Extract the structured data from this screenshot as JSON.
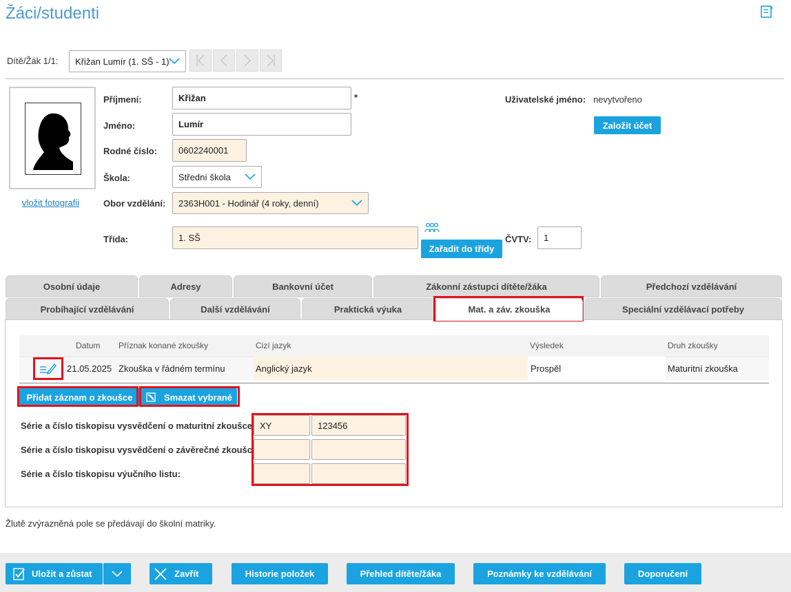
{
  "page": {
    "title": "Žáci/studenti"
  },
  "navigator": {
    "label": "Dítě/Žák 1/1:",
    "selected": "Křižan Lumír (1. SŠ - 1)"
  },
  "photo": {
    "link": "vložit fotografii"
  },
  "form": {
    "surname_label": "Příjmení:",
    "surname_value": "Křižan",
    "required_mark": "*",
    "name_label": "Jméno:",
    "name_value": "Lumír",
    "birth_label": "Rodné číslo:",
    "birth_value": "0602240001",
    "school_label": "Škola:",
    "school_value": "Střední škola",
    "field_label": "Obor vzdělání:",
    "field_value": "2363H001 - Hodinář (4 roky, denní)",
    "class_label": "Třída:",
    "class_value": "1. SŠ",
    "assign_button": "Zařadit do třídy",
    "cvtv_label": "ČVTV:",
    "cvtv_value": "1",
    "username_label": "Uživatelské jméno:",
    "username_value": "nevytvořeno",
    "create_account_button": "Založit účet"
  },
  "tabs_row1": [
    "Osobní údaje",
    "Adresy",
    "Bankovní účet",
    "Zákonní zástupci dítěte/žáka",
    "Předchozí vzdělávání"
  ],
  "tabs_row2": [
    "Probíhající vzdělávání",
    "Další vzdělávání",
    "Praktická výuka",
    "Mat. a záv. zkouška",
    "Speciální vzdělávací potřeby"
  ],
  "exam_table": {
    "headers": [
      "Datum",
      "Příznak konané zkoušky",
      "Cizí jazyk",
      "Výsledek",
      "Druh zkoušky"
    ],
    "rows": [
      {
        "date": "21.05.2025",
        "flag": "Zkouška v řádném termínu",
        "language": "Anglický jazyk",
        "result": "Prospěl",
        "type": "Maturitní zkouška"
      }
    ]
  },
  "actions": {
    "add": "Přidat záznam o zkoušce",
    "delete": "Smazat vybrané"
  },
  "certificates": {
    "maturita_label": "Série a číslo tiskopisu vysvědčení o maturitní zkoušce:",
    "maturita_series": "XY",
    "maturita_number": "123456",
    "final_label": "Série a číslo tiskopisu vysvědčení o závěrečné zkoušce:",
    "final_series": "",
    "final_number": "",
    "apprentice_label": "Série a číslo tiskopisu výučního listu:",
    "apprentice_series": "",
    "apprentice_number": ""
  },
  "note": "Žlutě zvýrazněná pole se předávají do školní matriky.",
  "footer": {
    "save": "Uložit a zůstat",
    "close": "Zavřít",
    "history": "Historie položek",
    "overview": "Přehled dítěte/žáka",
    "notes": "Poznámky ke vzdělávání",
    "recommend": "Doporučení"
  },
  "colors": {
    "accent": "#1ba3e0",
    "title": "#4a9ad8",
    "highlight": "#fdf2e2",
    "annotation": "#e0141e"
  },
  "icons": [
    "help-icon",
    "chevron-down-icon",
    "first-icon",
    "prev-icon",
    "next-icon",
    "last-icon",
    "silhouette-icon",
    "group-icon",
    "edit-icon",
    "delete-icon",
    "save-icon",
    "close-icon"
  ]
}
